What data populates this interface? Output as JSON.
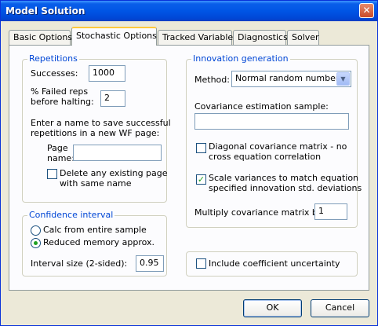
{
  "window": {
    "title": "Model Solution",
    "close_glyph": "✕"
  },
  "tabs": [
    {
      "label": "Basic Options",
      "active": false
    },
    {
      "label": "Stochastic Options",
      "active": true
    },
    {
      "label": "Tracked Variables",
      "active": false
    },
    {
      "label": "Diagnostics",
      "active": false
    },
    {
      "label": "Solver",
      "active": false
    }
  ],
  "repetitions": {
    "title": "Repetitions",
    "successes_label": "Successes:",
    "successes_value": "1000",
    "failed_label_1": "% Failed reps",
    "failed_label_2": "before halting:",
    "failed_value": "2",
    "save_text_1": "Enter a name to save successful",
    "save_text_2": "repetitions in a new WF page:",
    "page_label_1": "Page",
    "page_label_2": "name:",
    "page_value": "",
    "delete_label_1": "Delete any existing page",
    "delete_label_2": "with same name",
    "delete_checked": false
  },
  "confidence": {
    "title": "Confidence interval",
    "calc_label": "Calc from entire sample",
    "calc_selected": false,
    "reduced_label": "Reduced memory approx.",
    "reduced_selected": true,
    "interval_label": "Interval size (2-sided):",
    "interval_value": "0.95"
  },
  "innovation": {
    "title": "Innovation generation",
    "method_label": "Method:",
    "method_value": "Normal random numbers",
    "cov_sample_label": "Covariance estimation sample:",
    "cov_sample_value": "",
    "diag_label_1": "Diagonal covariance matrix - no",
    "diag_label_2": "cross equation correlation",
    "diag_checked": false,
    "scale_label_1": "Scale variances to match equation",
    "scale_label_2": "specified innovation std. deviations",
    "scale_checked": true,
    "multiply_label": "Multiply covariance matrix by:",
    "multiply_value": "1"
  },
  "uncertainty": {
    "label": "Include coefficient uncertainty",
    "checked": false
  },
  "buttons": {
    "ok": "OK",
    "cancel": "Cancel"
  },
  "check_glyph": "✓",
  "arrow_glyph": "▼"
}
